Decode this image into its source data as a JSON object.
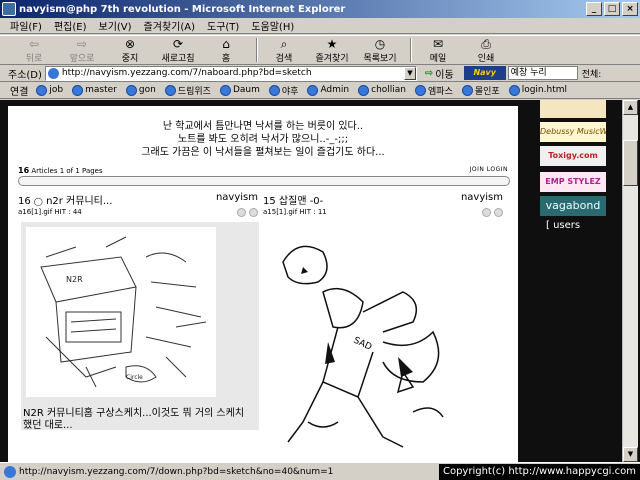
{
  "window": {
    "title": "navyism@php 7th revolution - Microsoft Internet Explorer"
  },
  "menu": [
    "파일(F)",
    "편집(E)",
    "보기(V)",
    "즐겨찾기(A)",
    "도구(T)",
    "도움말(H)"
  ],
  "toolbar": {
    "back": "뒤로",
    "forward": "앞으로",
    "stop": "중지",
    "refresh": "새로고침",
    "home": "홈",
    "search": "검색",
    "favorites": "즐겨찾기",
    "history": "목록보기",
    "mail": "메일",
    "print": "인쇄"
  },
  "address": {
    "label": "주소(D)",
    "url": "http://navyism.yezzang.com/7/naboard.php?bd=sketch",
    "go": "이동",
    "navy_logo": "Navy",
    "search_text": "예창 누리",
    "all": "전체:"
  },
  "links": {
    "label": "연결",
    "items": [
      "job",
      "master",
      "gon",
      "드림위즈",
      "Daum",
      "야후",
      "Admin",
      "chollian",
      "엠파스",
      "몰인포",
      "login.html"
    ]
  },
  "page": {
    "intro": [
      "난 학교에서 틈만나면 낙서를 하는 버릇이 있다..",
      "노트를 봐도 오히려 낙서가 많으니..-_-;;;",
      "그래도 가끔은 이 낙서들을 펼쳐보는 일이 즐겁기도 하다..."
    ],
    "article_count": "16",
    "article_info": "Articles 1 of 1 Pages",
    "join_login": "JOIN LOGIN",
    "posts": [
      {
        "number": "16",
        "title": "n2r 커뮤니티...",
        "author": "navyism",
        "meta": "a16[1].gif HIT : 44",
        "caption": "N2R 커뮤니티홈 구상스케치...이것도 뭐 거의 스케치했던 대로..."
      },
      {
        "number": "15",
        "title": "삽질맨 -0-",
        "author": "navyism",
        "meta": "a15[1].gif HIT : 11"
      }
    ]
  },
  "sidebar": {
    "banners": [
      "Debussy MusicWorld",
      "Toxigy.com",
      "EMP STYLEZ",
      "vagabond"
    ],
    "users": "[ users"
  },
  "status": {
    "url": "http://navyism.yezzang.com/7/down.php?bd=sketch&no=40&num=1",
    "copyright": "Copyright(c) http://www.happycgi.com"
  },
  "colors": {
    "titlebar_start": "#0a246a",
    "titlebar_end": "#a6caf0",
    "chrome": "#d4d0c8",
    "page_bg": "#0f0f0f"
  }
}
